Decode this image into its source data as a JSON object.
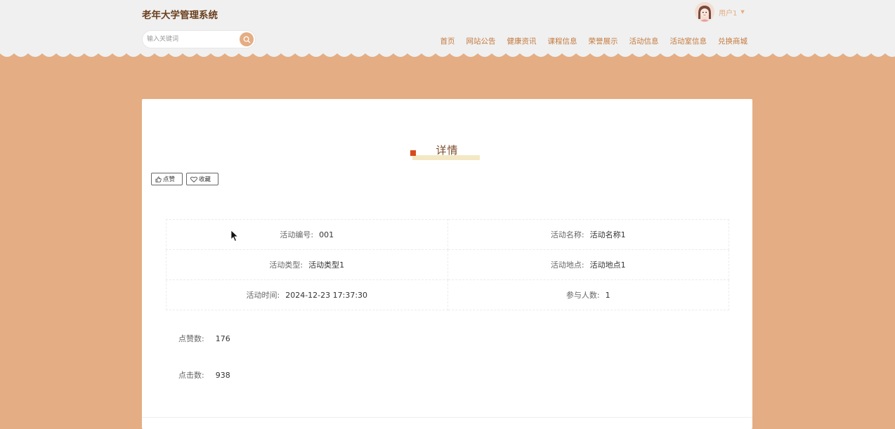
{
  "header": {
    "site_title": "老年大学管理系统",
    "search_placeholder": "输入关键词",
    "user_name": "用户1",
    "nav": [
      "首页",
      "网站公告",
      "健康资讯",
      "课程信息",
      "荣誉展示",
      "活动信息",
      "活动室信息",
      "兑换商城"
    ]
  },
  "detail": {
    "title": "详情",
    "like_label": "点赞",
    "fav_label": "收藏",
    "rows": [
      [
        {
          "label": "活动编号:",
          "value": "001"
        },
        {
          "label": "活动名称:",
          "value": "活动名称1"
        }
      ],
      [
        {
          "label": "活动类型:",
          "value": "活动类型1"
        },
        {
          "label": "活动地点:",
          "value": "活动地点1"
        }
      ],
      [
        {
          "label": "活动时间:",
          "value": "2024-12-23 17:37:30"
        },
        {
          "label": "参与人数:",
          "value": "1"
        }
      ]
    ],
    "likes_label": "点赞数:",
    "likes_value": "176",
    "clicks_label": "点击数:",
    "clicks_value": "938"
  },
  "colors": {
    "accent": "#e4ad83",
    "nav_text": "#c47a3f",
    "marker": "#d94a1a"
  },
  "icons": [
    "search-icon",
    "like-icon",
    "heart-icon",
    "chevron-down-icon",
    "avatar"
  ]
}
